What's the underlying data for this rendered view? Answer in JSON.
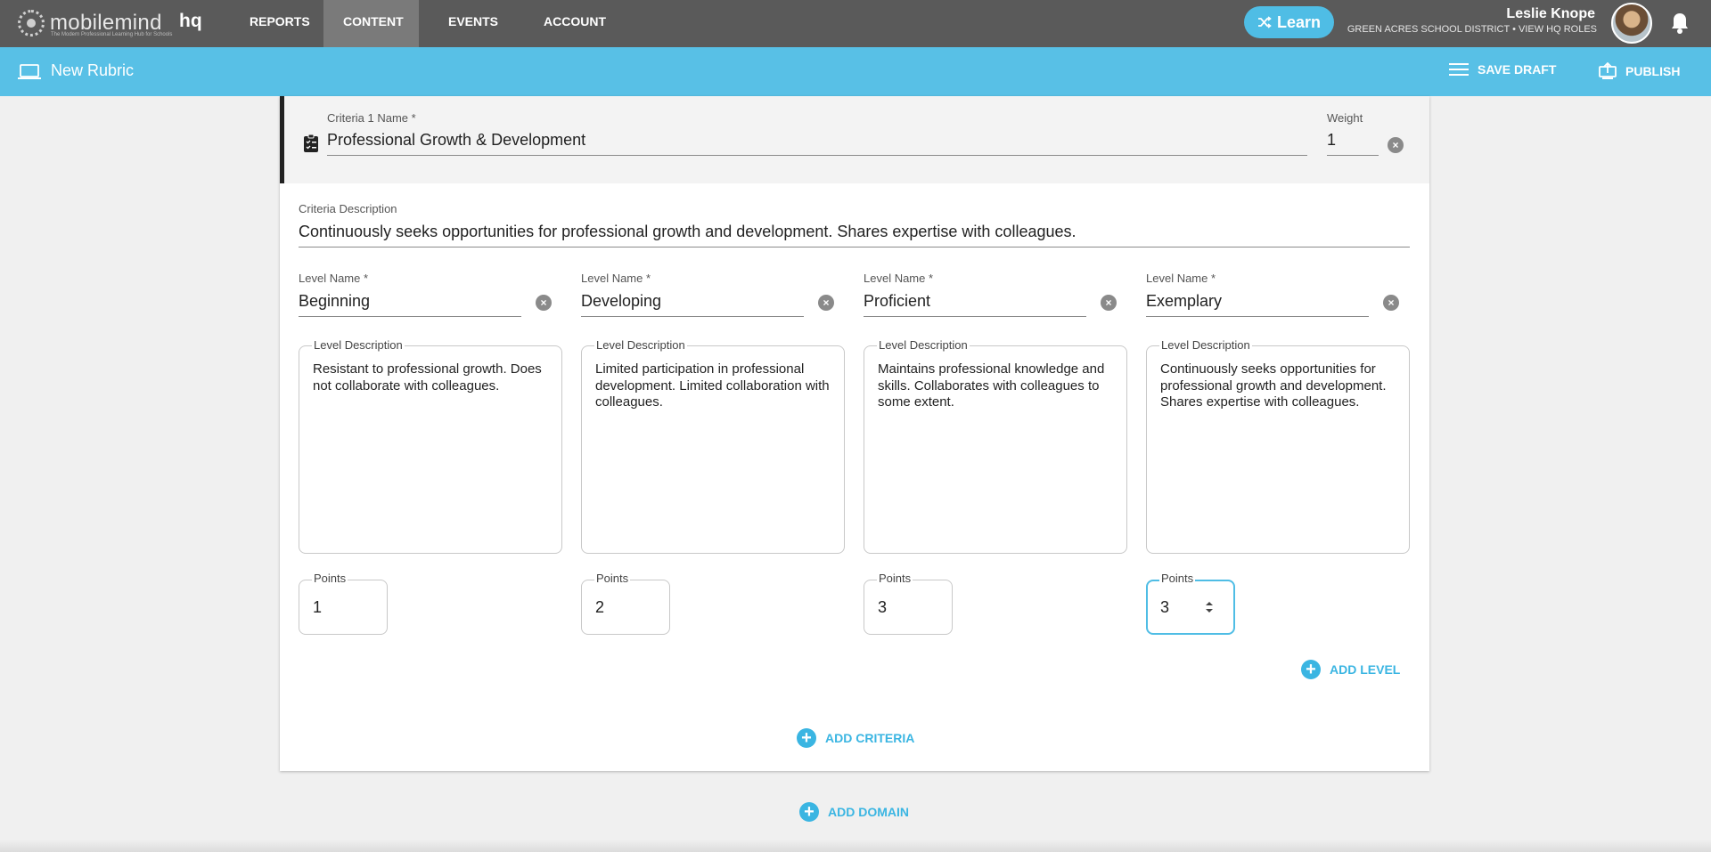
{
  "topnav": {
    "logo_text": "mobilemind",
    "logo_tagline": "The Modern Professional Learning Hub for Schools",
    "logo_suffix": "hq",
    "items": [
      {
        "label": "REPORTS"
      },
      {
        "label": "CONTENT",
        "active": true
      },
      {
        "label": "EVENTS"
      },
      {
        "label": "ACCOUNT"
      }
    ],
    "learn_label": "Learn",
    "user_name": "Leslie Knope",
    "user_subtitle": "GREEN ACRES SCHOOL DISTRICT • VIEW HQ ROLES"
  },
  "subbar": {
    "title": "New Rubric",
    "save_draft_label": "SAVE DRAFT",
    "publish_label": "PUBLISH"
  },
  "criteria": {
    "name_label": "Criteria 1 Name *",
    "name_value": "Professional Growth & Development",
    "weight_label": "Weight",
    "weight_value": "1",
    "description_label": "Criteria Description",
    "description_value": "Continuously seeks opportunities for professional growth and development. Shares expertise with colleagues.",
    "levels": [
      {
        "name_label": "Level Name *",
        "name": "Beginning",
        "desc_label": "Level Description",
        "description": "Resistant to professional growth. Does not collaborate with colleagues.",
        "points_label": "Points",
        "points": "1"
      },
      {
        "name_label": "Level Name *",
        "name": "Developing",
        "desc_label": "Level Description",
        "description": "Limited participation in professional development. Limited collaboration with colleagues.",
        "points_label": "Points",
        "points": "2"
      },
      {
        "name_label": "Level Name *",
        "name": "Proficient",
        "desc_label": "Level Description",
        "description": "Maintains professional knowledge and skills. Collaborates with colleagues to some extent.",
        "points_label": "Points",
        "points": "3"
      },
      {
        "name_label": "Level Name *",
        "name": "Exemplary",
        "desc_label": "Level Description",
        "description": "Continuously seeks opportunities for professional growth and development. Shares expertise with colleagues.",
        "points_label": "Points",
        "points": "3"
      }
    ],
    "add_level_label": "ADD LEVEL",
    "add_criteria_label": "ADD CRITERIA"
  },
  "add_domain_label": "ADD DOMAIN",
  "colors": {
    "nav_bg": "#5a5a5a",
    "accent": "#58c0e6",
    "link": "#3ab5e2"
  }
}
